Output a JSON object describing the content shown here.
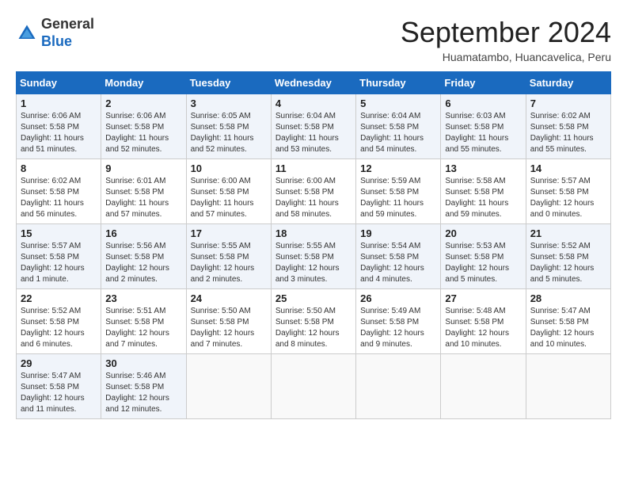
{
  "header": {
    "logo_line1": "General",
    "logo_line2": "Blue",
    "month_title": "September 2024",
    "location": "Huamatambo, Huancavelica, Peru"
  },
  "weekdays": [
    "Sunday",
    "Monday",
    "Tuesday",
    "Wednesday",
    "Thursday",
    "Friday",
    "Saturday"
  ],
  "weeks": [
    [
      {
        "day": "1",
        "sunrise": "6:06 AM",
        "sunset": "5:58 PM",
        "daylight": "11 hours and 51 minutes."
      },
      {
        "day": "2",
        "sunrise": "6:06 AM",
        "sunset": "5:58 PM",
        "daylight": "11 hours and 52 minutes."
      },
      {
        "day": "3",
        "sunrise": "6:05 AM",
        "sunset": "5:58 PM",
        "daylight": "11 hours and 52 minutes."
      },
      {
        "day": "4",
        "sunrise": "6:04 AM",
        "sunset": "5:58 PM",
        "daylight": "11 hours and 53 minutes."
      },
      {
        "day": "5",
        "sunrise": "6:04 AM",
        "sunset": "5:58 PM",
        "daylight": "11 hours and 54 minutes."
      },
      {
        "day": "6",
        "sunrise": "6:03 AM",
        "sunset": "5:58 PM",
        "daylight": "11 hours and 55 minutes."
      },
      {
        "day": "7",
        "sunrise": "6:02 AM",
        "sunset": "5:58 PM",
        "daylight": "11 hours and 55 minutes."
      }
    ],
    [
      {
        "day": "8",
        "sunrise": "6:02 AM",
        "sunset": "5:58 PM",
        "daylight": "11 hours and 56 minutes."
      },
      {
        "day": "9",
        "sunrise": "6:01 AM",
        "sunset": "5:58 PM",
        "daylight": "11 hours and 57 minutes."
      },
      {
        "day": "10",
        "sunrise": "6:00 AM",
        "sunset": "5:58 PM",
        "daylight": "11 hours and 57 minutes."
      },
      {
        "day": "11",
        "sunrise": "6:00 AM",
        "sunset": "5:58 PM",
        "daylight": "11 hours and 58 minutes."
      },
      {
        "day": "12",
        "sunrise": "5:59 AM",
        "sunset": "5:58 PM",
        "daylight": "11 hours and 59 minutes."
      },
      {
        "day": "13",
        "sunrise": "5:58 AM",
        "sunset": "5:58 PM",
        "daylight": "11 hours and 59 minutes."
      },
      {
        "day": "14",
        "sunrise": "5:57 AM",
        "sunset": "5:58 PM",
        "daylight": "12 hours and 0 minutes."
      }
    ],
    [
      {
        "day": "15",
        "sunrise": "5:57 AM",
        "sunset": "5:58 PM",
        "daylight": "12 hours and 1 minute."
      },
      {
        "day": "16",
        "sunrise": "5:56 AM",
        "sunset": "5:58 PM",
        "daylight": "12 hours and 2 minutes."
      },
      {
        "day": "17",
        "sunrise": "5:55 AM",
        "sunset": "5:58 PM",
        "daylight": "12 hours and 2 minutes."
      },
      {
        "day": "18",
        "sunrise": "5:55 AM",
        "sunset": "5:58 PM",
        "daylight": "12 hours and 3 minutes."
      },
      {
        "day": "19",
        "sunrise": "5:54 AM",
        "sunset": "5:58 PM",
        "daylight": "12 hours and 4 minutes."
      },
      {
        "day": "20",
        "sunrise": "5:53 AM",
        "sunset": "5:58 PM",
        "daylight": "12 hours and 5 minutes."
      },
      {
        "day": "21",
        "sunrise": "5:52 AM",
        "sunset": "5:58 PM",
        "daylight": "12 hours and 5 minutes."
      }
    ],
    [
      {
        "day": "22",
        "sunrise": "5:52 AM",
        "sunset": "5:58 PM",
        "daylight": "12 hours and 6 minutes."
      },
      {
        "day": "23",
        "sunrise": "5:51 AM",
        "sunset": "5:58 PM",
        "daylight": "12 hours and 7 minutes."
      },
      {
        "day": "24",
        "sunrise": "5:50 AM",
        "sunset": "5:58 PM",
        "daylight": "12 hours and 7 minutes."
      },
      {
        "day": "25",
        "sunrise": "5:50 AM",
        "sunset": "5:58 PM",
        "daylight": "12 hours and 8 minutes."
      },
      {
        "day": "26",
        "sunrise": "5:49 AM",
        "sunset": "5:58 PM",
        "daylight": "12 hours and 9 minutes."
      },
      {
        "day": "27",
        "sunrise": "5:48 AM",
        "sunset": "5:58 PM",
        "daylight": "12 hours and 10 minutes."
      },
      {
        "day": "28",
        "sunrise": "5:47 AM",
        "sunset": "5:58 PM",
        "daylight": "12 hours and 10 minutes."
      }
    ],
    [
      {
        "day": "29",
        "sunrise": "5:47 AM",
        "sunset": "5:58 PM",
        "daylight": "12 hours and 11 minutes."
      },
      {
        "day": "30",
        "sunrise": "5:46 AM",
        "sunset": "5:58 PM",
        "daylight": "12 hours and 12 minutes."
      },
      null,
      null,
      null,
      null,
      null
    ]
  ]
}
